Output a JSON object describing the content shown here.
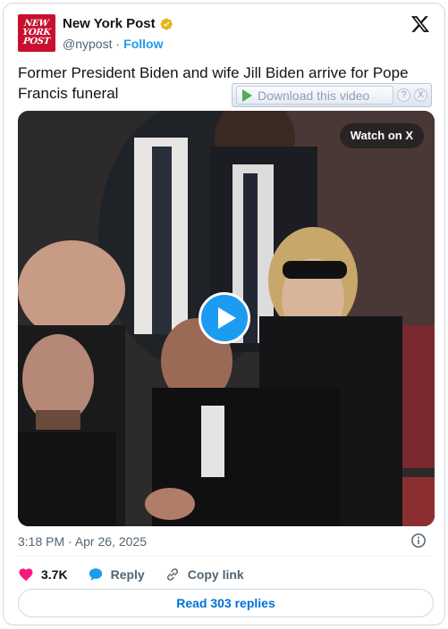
{
  "account": {
    "logo_lines": [
      "NEW",
      "YORK",
      "POST"
    ],
    "name": "New York Post",
    "handle": "@nypost",
    "separator": "·",
    "follow_label": "Follow",
    "verified_badge": "gold-verified-badge-icon"
  },
  "tweet": {
    "text": "Former President Biden and wife Jill Biden arrive for Pope Francis funeral"
  },
  "download_overlay": {
    "label": "Download this video",
    "help": "?",
    "close": "X"
  },
  "video": {
    "watch_label": "Watch on X",
    "play_icon": "play-icon"
  },
  "footer": {
    "timestamp": "3:18 PM · Apr 26, 2025",
    "like_count": "3.7K",
    "reply_label": "Reply",
    "copy_link_label": "Copy link",
    "read_replies_label": "Read 303 replies"
  },
  "colors": {
    "accent": "#1d9bf0",
    "like": "#f91880",
    "brand_red": "#c8102e",
    "verified_gold": "#e2b719"
  }
}
